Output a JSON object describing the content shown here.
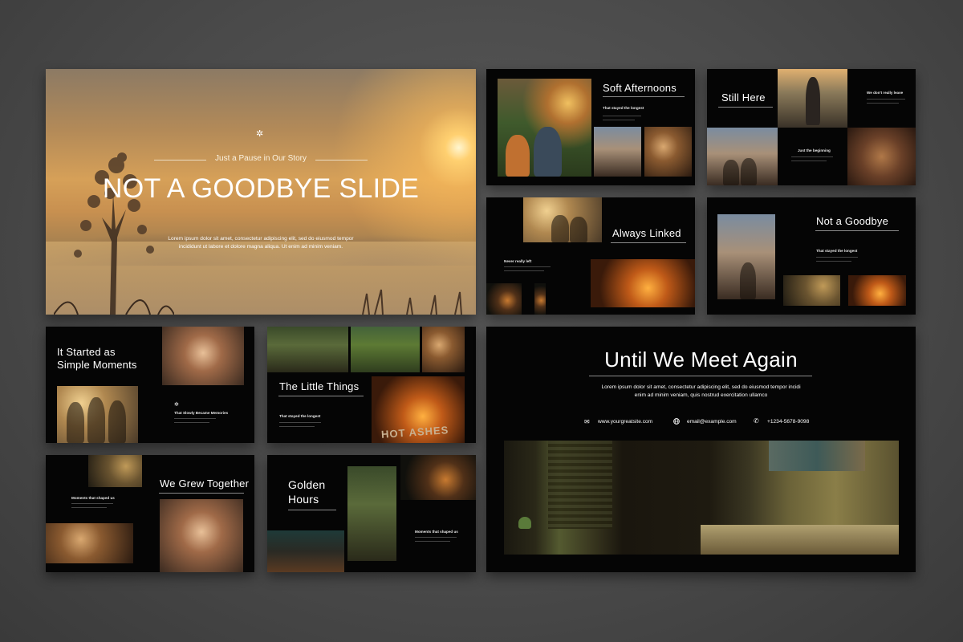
{
  "hero": {
    "tagline": "Just a Pause in Our Story",
    "title": "NOT A GOODBYE SLIDE",
    "body_line1": "Lorem ipsum dolor sit amet, consectetur adipiscing elit, sed do eiusmod tempor",
    "body_line2": "incididunt ut labore et dolore magna aliqua. Ut enim ad minim veniam."
  },
  "soft_afternoons": {
    "title": "Soft Afternoons",
    "caption": "That stayed the longest"
  },
  "still_here": {
    "title": "Still Here",
    "caption_top": "We don't really leave",
    "caption_bottom": "Just the beginning"
  },
  "always_linked": {
    "title": "Always Linked",
    "caption": "Never really left"
  },
  "not_a_goodbye": {
    "title": "Not a Goodbye",
    "caption": "That stayed the longest"
  },
  "simple_moments": {
    "title_line1": "It Started as",
    "title_line2": "Simple Moments",
    "caption": "That Slowly Became Memories"
  },
  "little_things": {
    "title": "The Little Things",
    "caption": "That stayed the longest",
    "sign_text": "HOT ASHES"
  },
  "until": {
    "title": "Until We Meet Again",
    "body_line1": "Lorem ipsum dolor sit amet, consectetur adipiscing elit, sed do eiusmod tempor incidi",
    "body_line2": "enim ad minim veniam, quis nostrud exercitation ullamco",
    "website": "www.yourgreatsite.com",
    "email": "email@example.com",
    "phone": "+1234-5678-9098"
  },
  "grew_together": {
    "title": "We Grew Together",
    "caption": "Moments that shaped us"
  },
  "golden_hours": {
    "title_line1": "Golden",
    "title_line2": "Hours",
    "caption": "Moments that shaped us"
  },
  "colors": {
    "slide_bg": "#050505",
    "canvas_bg": "#4a4a4a",
    "text": "#ffffff",
    "sun": "#ffd070"
  },
  "icons": [
    "sun-icon",
    "envelope-icon",
    "globe-icon",
    "phone-icon"
  ]
}
